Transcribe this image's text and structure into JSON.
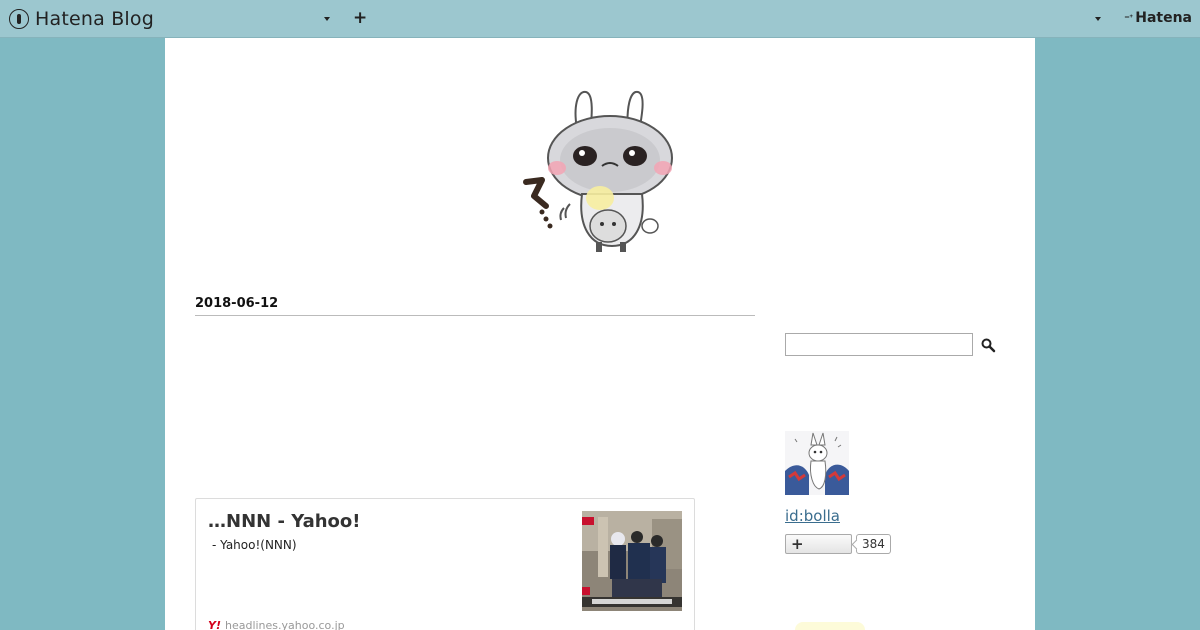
{
  "topbar": {
    "brand_text": "Hatena Blog",
    "hatena_logo_text": "Hatena",
    "add_label": "+"
  },
  "entry": {
    "date": "2018-06-12"
  },
  "embed": {
    "title": "…NNN - Yahoo!",
    "description": " - Yahoo!(NNN)",
    "site": "headlines.yahoo.co.jp",
    "favicon": "Y!"
  },
  "sidebar": {
    "search_placeholder": "",
    "profile_id": "id:bolla",
    "subscribe_label": "+",
    "subscriber_count": "384"
  },
  "colors": {
    "background": "#7fb9c2",
    "topbar": "#9cc7cf",
    "link": "#3a6d8e"
  }
}
